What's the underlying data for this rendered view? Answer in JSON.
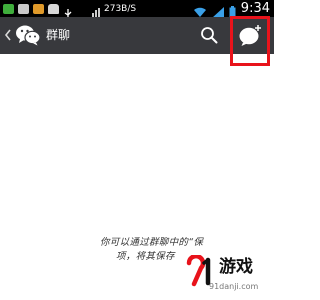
{
  "status_bar": {
    "net_speed": "273B/S",
    "clock": "9:34",
    "icons": [
      "gallery-icon",
      "app-icon",
      "app-icon",
      "bag-icon",
      "usb-icon",
      "signal-icon",
      "wifi-icon",
      "cellular-signal-icon",
      "battery-icon"
    ]
  },
  "title_bar": {
    "title": "群聊",
    "background": "#38393d",
    "icons": {
      "back": "back-arrow-icon",
      "logo": "wechat-logo-icon",
      "search": "search-icon",
      "new_group": "new-group-chat-icon"
    }
  },
  "annotation": {
    "highlight_color": "#e8131b"
  },
  "content": {
    "hint_line1": "你可以通过群聊中的“保",
    "hint_line2": "项，将其保存"
  },
  "watermark": {
    "brand": "游戏",
    "logo_text": "91",
    "url": "91danji.com",
    "accent": "#e8131b"
  }
}
